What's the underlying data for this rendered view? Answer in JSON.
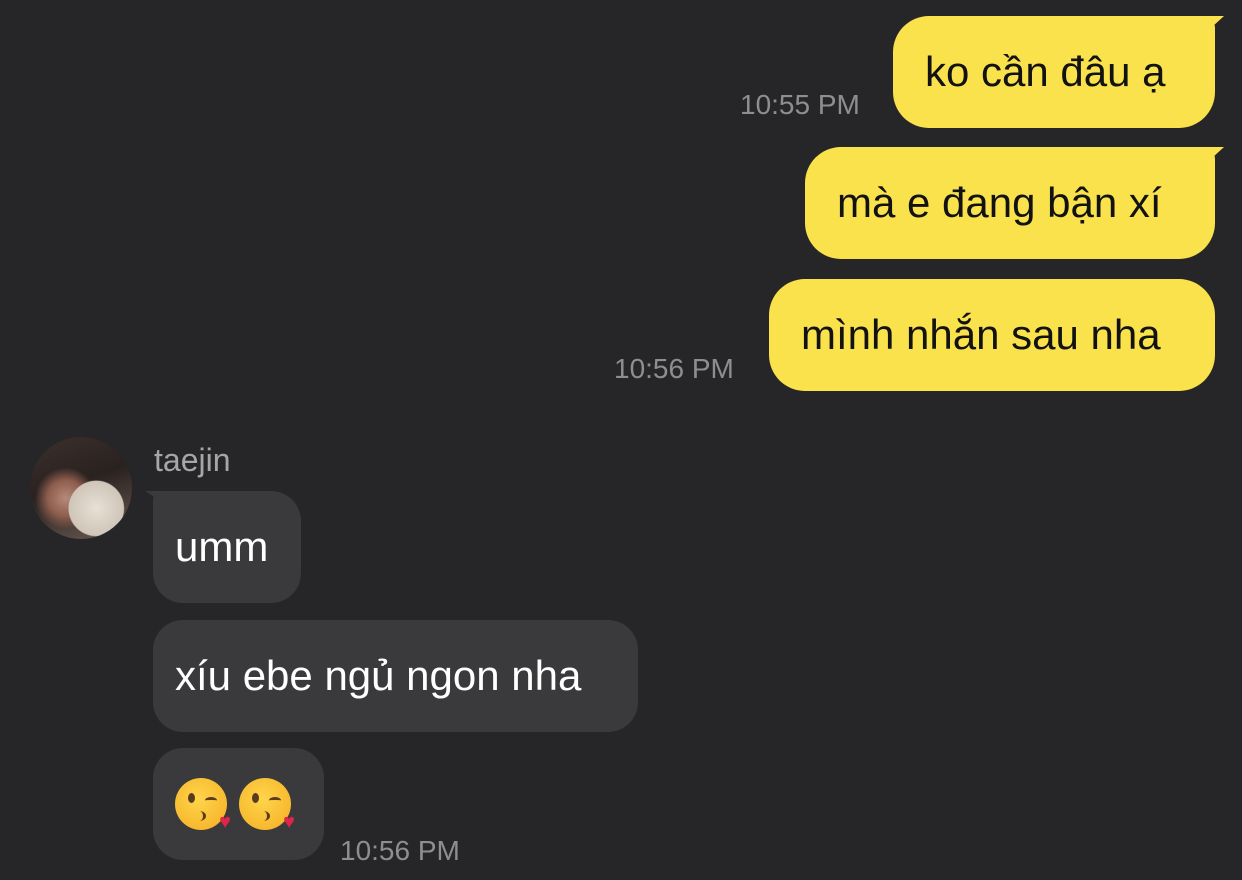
{
  "outgoing_messages": [
    {
      "text": "ko cần đâu ạ"
    },
    {
      "text": "mà e đang bận xí"
    },
    {
      "text": "mình nhắn sau nha"
    }
  ],
  "outgoing_times": [
    "10:55 PM",
    "10:56 PM"
  ],
  "contact": {
    "name": "taejin",
    "avatar": "profile-photo"
  },
  "incoming_messages": [
    {
      "text": "umm"
    },
    {
      "text": "xíu ebe ngủ ngon nha"
    }
  ],
  "incoming_emoji": [
    "kiss-face-emoji",
    "kiss-face-emoji"
  ],
  "incoming_time": "10:56 PM",
  "colors": {
    "background": "#262628",
    "outgoing_bubble": "#f9e24c",
    "incoming_bubble": "#3a3a3c",
    "timestamp": "#8e8e90"
  }
}
